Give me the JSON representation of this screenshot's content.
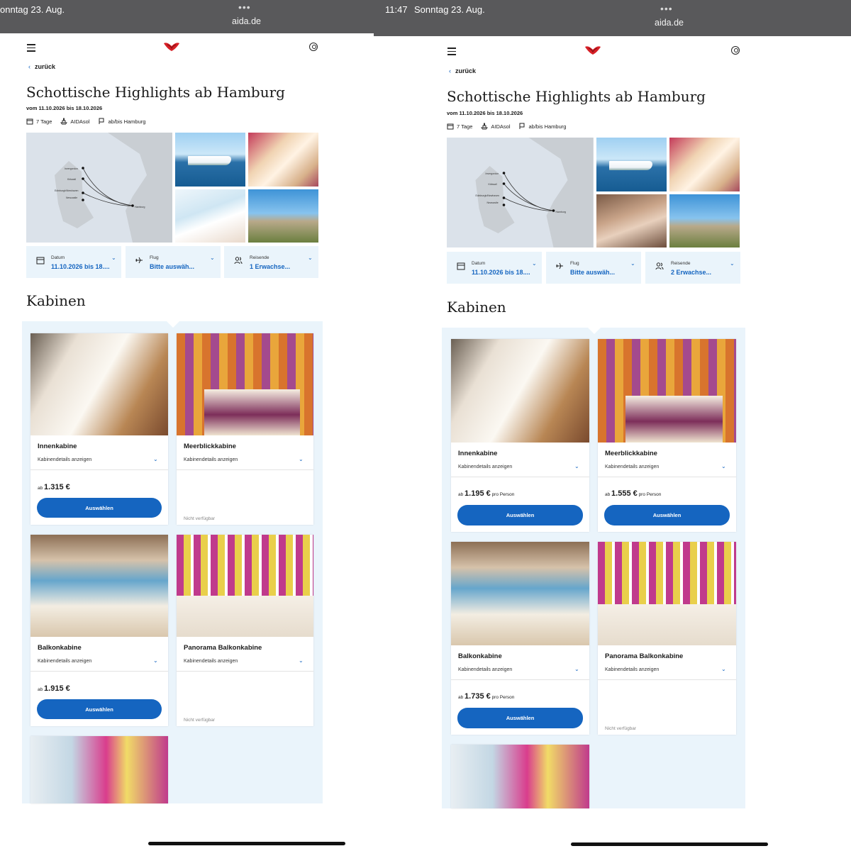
{
  "left": {
    "status": {
      "time_fragment": "onntag 23. Aug.",
      "dots": "•••",
      "url": "aida.de"
    },
    "back_label": "zurück",
    "title": "Schottische Highlights ab Hamburg",
    "dates": "vom 11.10.2026 bis 18.10.2026",
    "meta": {
      "days": "7 Tage",
      "ship": "AIDAsol",
      "route": "ab/bis Hamburg"
    },
    "map_labels": [
      "Invergordon",
      "Kirkwall",
      "Edinburgh/Newhaven",
      "Newcastle",
      "Hamburg"
    ],
    "options": [
      {
        "label": "Datum",
        "value": "11.10.2026 bis 18...."
      },
      {
        "label": "Flug",
        "value": "Bitte auswäh..."
      },
      {
        "label": "Reisende",
        "value": "1 Erwachse..."
      }
    ],
    "section_title": "Kabinen",
    "details_label": "Kabinendetails anzeigen",
    "cabins": [
      {
        "name": "Innenkabine",
        "prefix": "ab",
        "price": "1.315 €",
        "button": "Auswählen"
      },
      {
        "name": "Meerblickkabine",
        "unavailable": "Nicht verfügbar"
      },
      {
        "name": "Balkonkabine",
        "prefix": "ab",
        "price": "1.915 €",
        "button": "Auswählen"
      },
      {
        "name": "Panorama Balkonkabine",
        "unavailable": "Nicht verfügbar"
      }
    ]
  },
  "right": {
    "status": {
      "time": "11:47",
      "date": "Sonntag 23. Aug.",
      "dots": "•••",
      "url": "aida.de"
    },
    "back_label": "zurück",
    "title": "Schottische Highlights ab Hamburg",
    "dates": "vom 11.10.2026 bis 18.10.2026",
    "meta": {
      "days": "7 Tage",
      "ship": "AIDAsol",
      "route": "ab/bis Hamburg"
    },
    "map_labels": [
      "Invergordon",
      "Kirkwall",
      "Edinburgh/Newhaven",
      "Newcastle",
      "Hamburg"
    ],
    "options": [
      {
        "label": "Datum",
        "value": "11.10.2026 bis 18...."
      },
      {
        "label": "Flug",
        "value": "Bitte auswäh..."
      },
      {
        "label": "Reisende",
        "value": "2 Erwachse..."
      }
    ],
    "section_title": "Kabinen",
    "details_label": "Kabinendetails anzeigen",
    "per_person": "pro Person",
    "cabins": [
      {
        "name": "Innenkabine",
        "prefix": "ab",
        "price": "1.195 €",
        "button": "Auswählen"
      },
      {
        "name": "Meerblickkabine",
        "prefix": "ab",
        "price": "1.555 €",
        "button": "Auswählen"
      },
      {
        "name": "Balkonkabine",
        "prefix": "ab",
        "price": "1.735 €",
        "button": "Auswählen"
      },
      {
        "name": "Panorama Balkonkabine",
        "unavailable": "Nicht verfügbar"
      }
    ]
  },
  "colors": {
    "accent": "#1565c0",
    "panel_bg": "#eaf4fb",
    "status_bar": "#59595b",
    "brand_red": "#d61f26"
  }
}
